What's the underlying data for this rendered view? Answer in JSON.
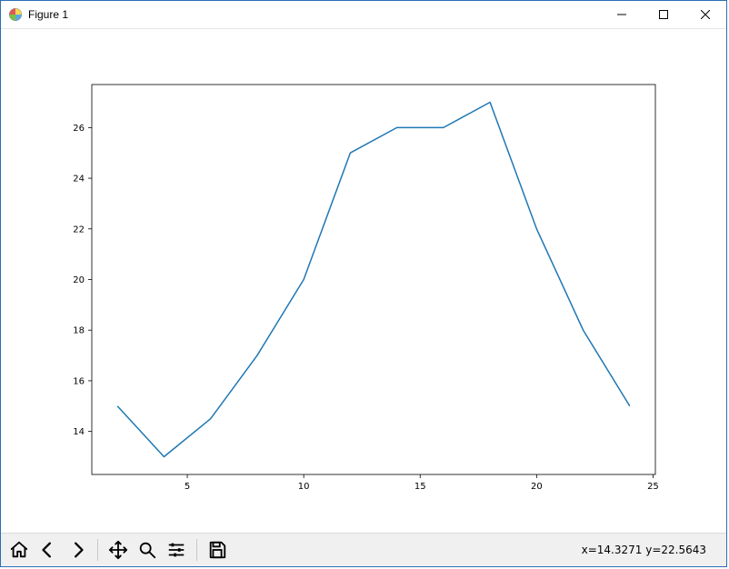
{
  "window": {
    "title": "Figure 1"
  },
  "toolbar": {
    "coord_text": "x=14.3271     y=22.5643"
  },
  "chart_data": {
    "type": "line",
    "x": [
      2,
      4,
      6,
      8,
      10,
      12,
      14,
      16,
      18,
      20,
      22,
      24
    ],
    "y": [
      15,
      13,
      14.5,
      17,
      20,
      25,
      26,
      26,
      27,
      22,
      18,
      15
    ],
    "xlim": [
      0.9,
      25.1
    ],
    "ylim": [
      12.3,
      27.7
    ],
    "xticks": [
      5,
      10,
      15,
      20,
      25
    ],
    "yticks": [
      14,
      16,
      18,
      20,
      22,
      24,
      26
    ],
    "title": "",
    "xlabel": "",
    "ylabel": "",
    "line_color": "#1f77b4"
  }
}
